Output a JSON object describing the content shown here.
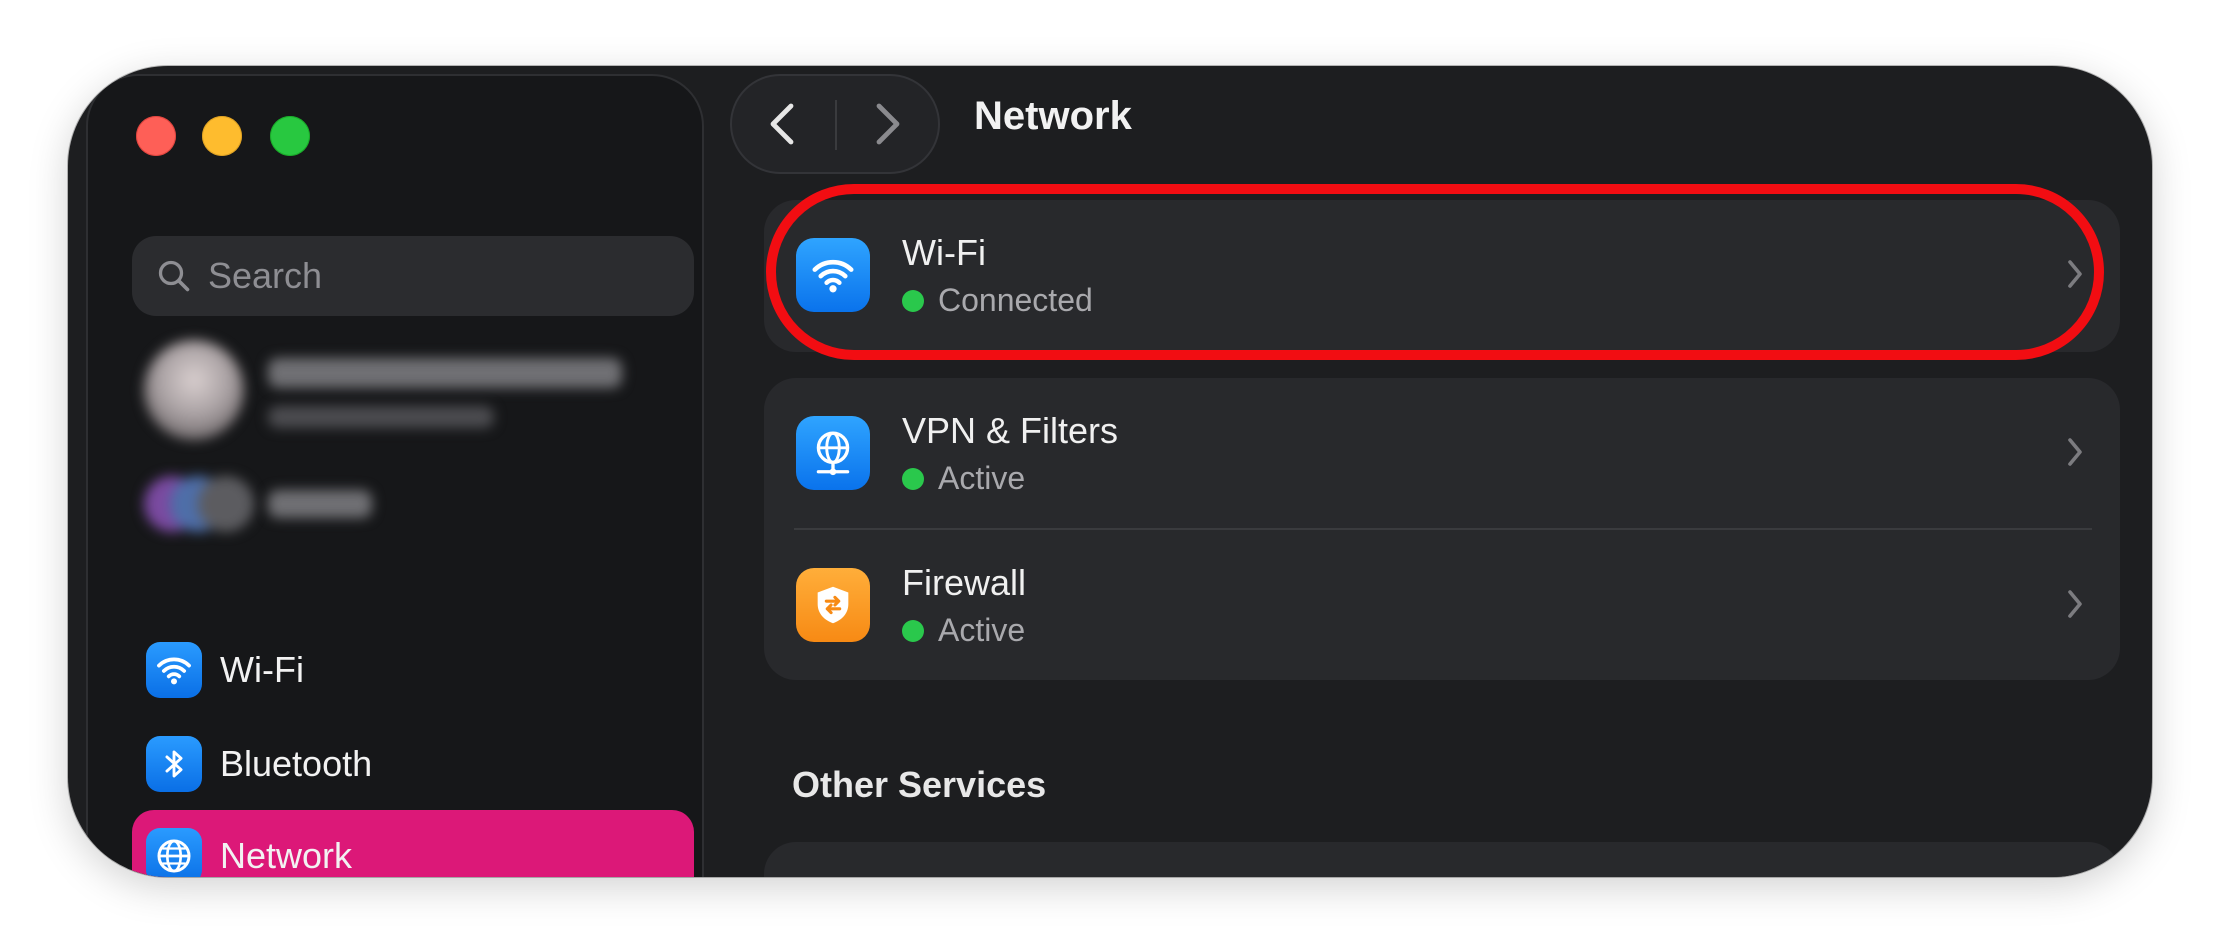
{
  "window": {
    "title": "Network",
    "traffic_lights": [
      "close",
      "minimize",
      "zoom"
    ]
  },
  "sidebar": {
    "search_placeholder": "Search",
    "items": [
      {
        "label": "Wi-Fi",
        "icon": "wifi-icon",
        "active": false
      },
      {
        "label": "Bluetooth",
        "icon": "bluetooth-icon",
        "active": false
      },
      {
        "label": "Network",
        "icon": "globe-icon",
        "active": true
      }
    ]
  },
  "toolbar": {
    "back_icon": "chevron-left-icon",
    "forward_icon": "chevron-right-icon"
  },
  "main": {
    "services": [
      {
        "title": "Wi-Fi",
        "status": "Connected",
        "icon": "wifi-icon",
        "status_color": "#2ac84c",
        "highlighted": true
      },
      {
        "title": "VPN & Filters",
        "status": "Active",
        "icon": "vpn-globe-icon",
        "status_color": "#2ac84c"
      },
      {
        "title": "Firewall",
        "status": "Active",
        "icon": "firewall-shield-icon",
        "status_color": "#2ac84c"
      }
    ],
    "other_services_title": "Other Services"
  },
  "colors": {
    "accent": "#dc1878",
    "highlight": "#f20d12",
    "status_active": "#2ac84c",
    "icon_blue": "#0a84ff",
    "icon_orange": "#f78a14"
  }
}
